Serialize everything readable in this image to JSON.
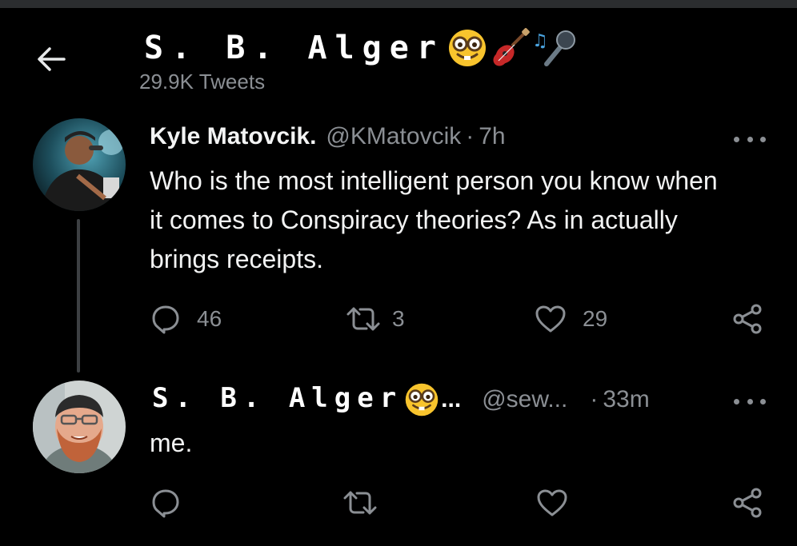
{
  "header": {
    "profile_name": "S. B. Alger",
    "profile_emojis": [
      "nerd-face-emoji",
      "guitar-emoji",
      "microphone-emoji"
    ],
    "tweet_count": "29.9K Tweets"
  },
  "tweets": [
    {
      "author_name": "Kyle Matovcik.",
      "handle": "@KMatovcik",
      "separator": "·",
      "time": "7h",
      "text": "Who is the most intelligent person you know when it comes to Conspiracy theories? As in actually brings receipts.",
      "replies": "46",
      "retweets": "3",
      "likes": "29"
    },
    {
      "author_name": "S. B. Alger",
      "name_truncation": "...",
      "handle": "@sew...",
      "separator": "·",
      "time": "33m",
      "text": "me."
    }
  ],
  "colors": {
    "background": "#000000",
    "text_primary": "#e7e9ea",
    "text_secondary": "#8b8f94",
    "thread_line": "#3d4043"
  }
}
